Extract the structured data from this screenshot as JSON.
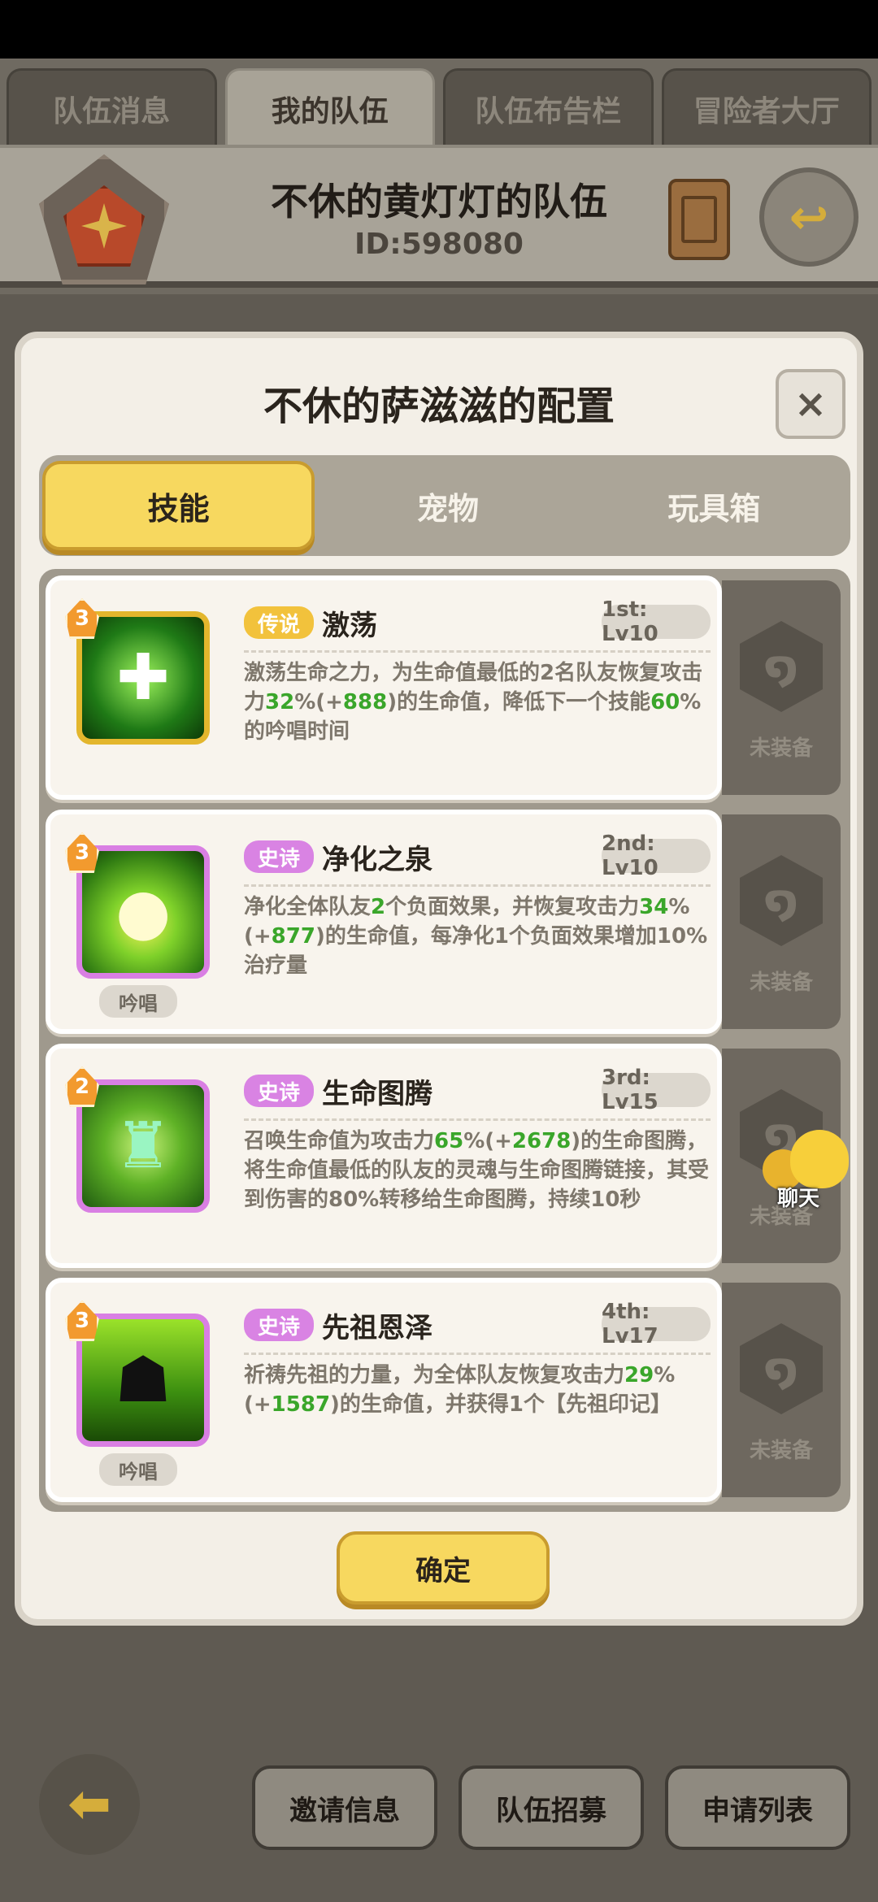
{
  "top_tabs": [
    "队伍消息",
    "我的队伍",
    "队伍布告栏",
    "冒险者大厅"
  ],
  "team": {
    "name": "不休的黄灯灯的队伍",
    "id": "ID:598080"
  },
  "modal": {
    "title": "不休的萨滋滋的配置",
    "close": "×",
    "sub_tabs": [
      "技能",
      "宠物",
      "玩具箱"
    ],
    "confirm": "确定"
  },
  "skills": [
    {
      "level": "3",
      "rarity": "传说",
      "name": "激荡",
      "rank": "1st: Lv10",
      "chant": "",
      "desc": [
        {
          "t": "激荡生命之力，为生命值最低的2名队友恢复攻击力"
        },
        {
          "t": "32",
          "g": true
        },
        {
          "t": "%(+"
        },
        {
          "t": "888",
          "g": true
        },
        {
          "t": ")的生命值，降低下一个技能"
        },
        {
          "t": "60",
          "g": true
        },
        {
          "t": "%的吟唱时间"
        }
      ],
      "slot": "未装备"
    },
    {
      "level": "3",
      "rarity": "史诗",
      "name": "净化之泉",
      "rank": "2nd: Lv10",
      "chant": "吟唱",
      "desc": [
        {
          "t": "净化全体队友"
        },
        {
          "t": "2",
          "g": true
        },
        {
          "t": "个负面效果，并恢复攻击力"
        },
        {
          "t": "34",
          "g": true
        },
        {
          "t": "%(+"
        },
        {
          "t": "877",
          "g": true
        },
        {
          "t": ")的生命值，每净化1个负面效果增加10%治疗量"
        }
      ],
      "slot": "未装备"
    },
    {
      "level": "2",
      "rarity": "史诗",
      "name": "生命图腾",
      "rank": "3rd: Lv15",
      "chant": "",
      "desc": [
        {
          "t": "召唤生命值为攻击力"
        },
        {
          "t": "65",
          "g": true
        },
        {
          "t": "%(+"
        },
        {
          "t": "2678",
          "g": true
        },
        {
          "t": ")的生命图腾，将生命值最低的队友的灵魂与生命图腾链接，其受到伤害的80%转移给生命图腾，持续10秒"
        }
      ],
      "slot": "未装备"
    },
    {
      "level": "3",
      "rarity": "史诗",
      "name": "先祖恩泽",
      "rank": "4th: Lv17",
      "chant": "吟唱",
      "desc": [
        {
          "t": "祈祷先祖的力量，为全体队友恢复攻击力"
        },
        {
          "t": "29",
          "g": true
        },
        {
          "t": "%(+"
        },
        {
          "t": "1587",
          "g": true
        },
        {
          "t": ")的生命值，并获得1个【先祖印记】"
        }
      ],
      "slot": "未装备"
    }
  ],
  "chat_label": "聊天",
  "bottom_buttons": [
    "邀请信息",
    "队伍招募",
    "申请列表"
  ],
  "colors": {
    "accent_yellow": "#f7d85f",
    "legend": "#f2c23c",
    "epic": "#d983e3",
    "highlight_green": "#3aa62a"
  }
}
